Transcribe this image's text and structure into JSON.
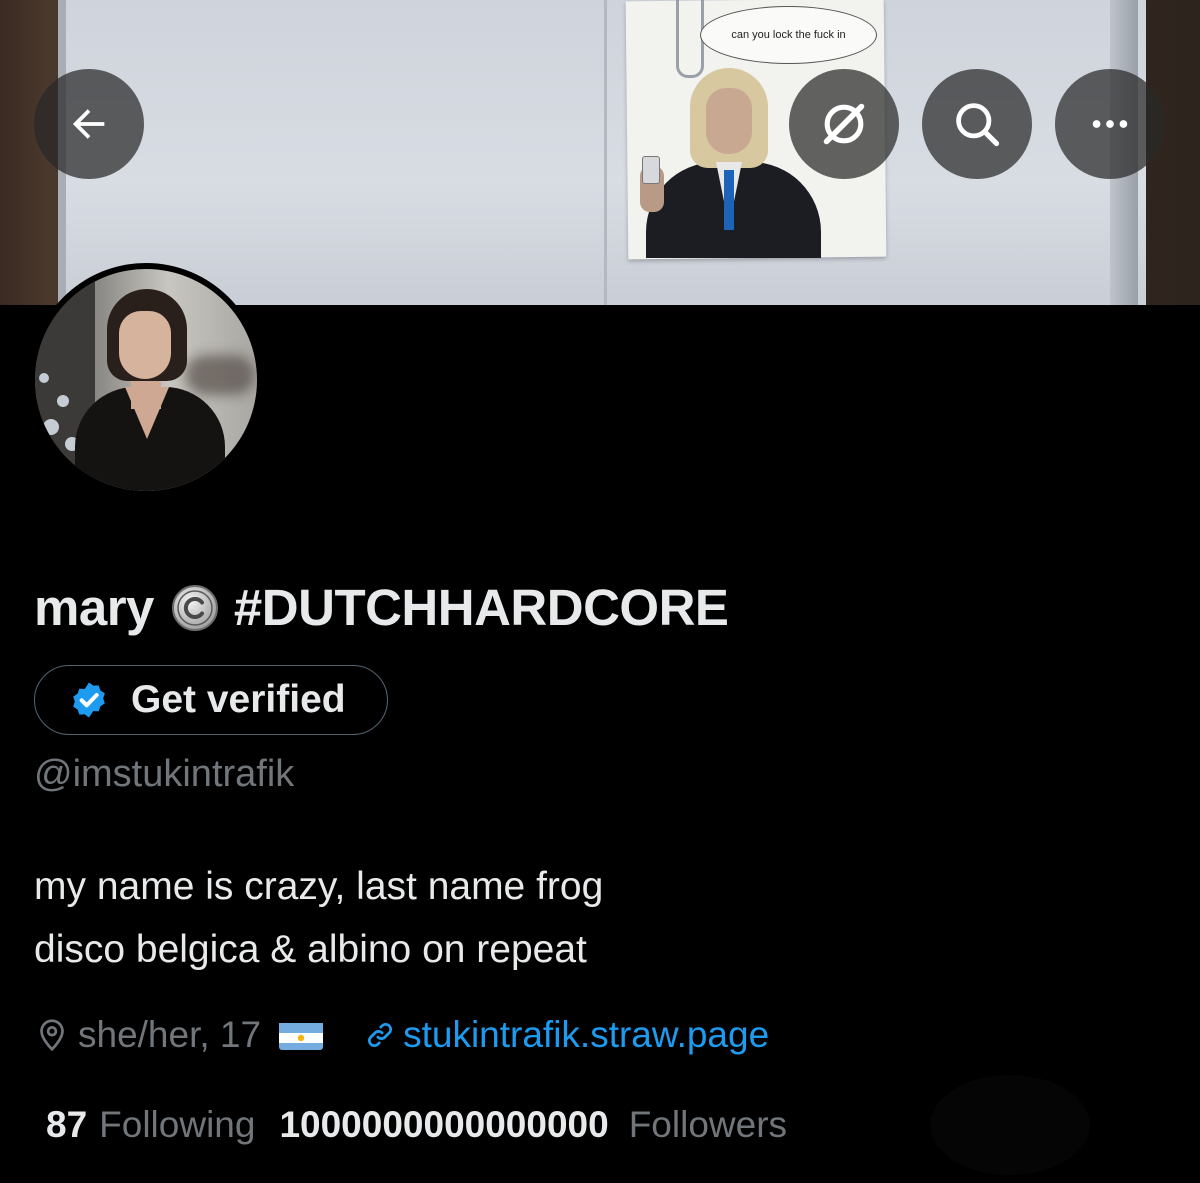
{
  "banner": {
    "speech_bubble_text": "can you lock the fuck in"
  },
  "nav": {
    "back_icon": "arrow-left-icon",
    "grok_icon": "grok-icon",
    "search_icon": "search-icon",
    "more_icon": "more-horizontal-icon"
  },
  "profile": {
    "display_name": "mary",
    "name_suffix": "#DUTCHHARDCORE",
    "verify_button_label": "Get verified",
    "handle": "@imstukintrafik",
    "bio_lines": [
      "my name is crazy, last name frog",
      "disco belgica & albino on repeat"
    ],
    "location": "she/her, 17",
    "website": "stukintrafik.straw.page",
    "following_count": "87",
    "following_label": "Following",
    "followers_count": "1000000000000000",
    "followers_label": "Followers"
  },
  "colors": {
    "background": "#000000",
    "primary_text": "#e7e9ea",
    "secondary_text": "#71767b",
    "link": "#1d9bf0",
    "verified_badge": "#1d9bf0",
    "button_border": "#536471"
  }
}
